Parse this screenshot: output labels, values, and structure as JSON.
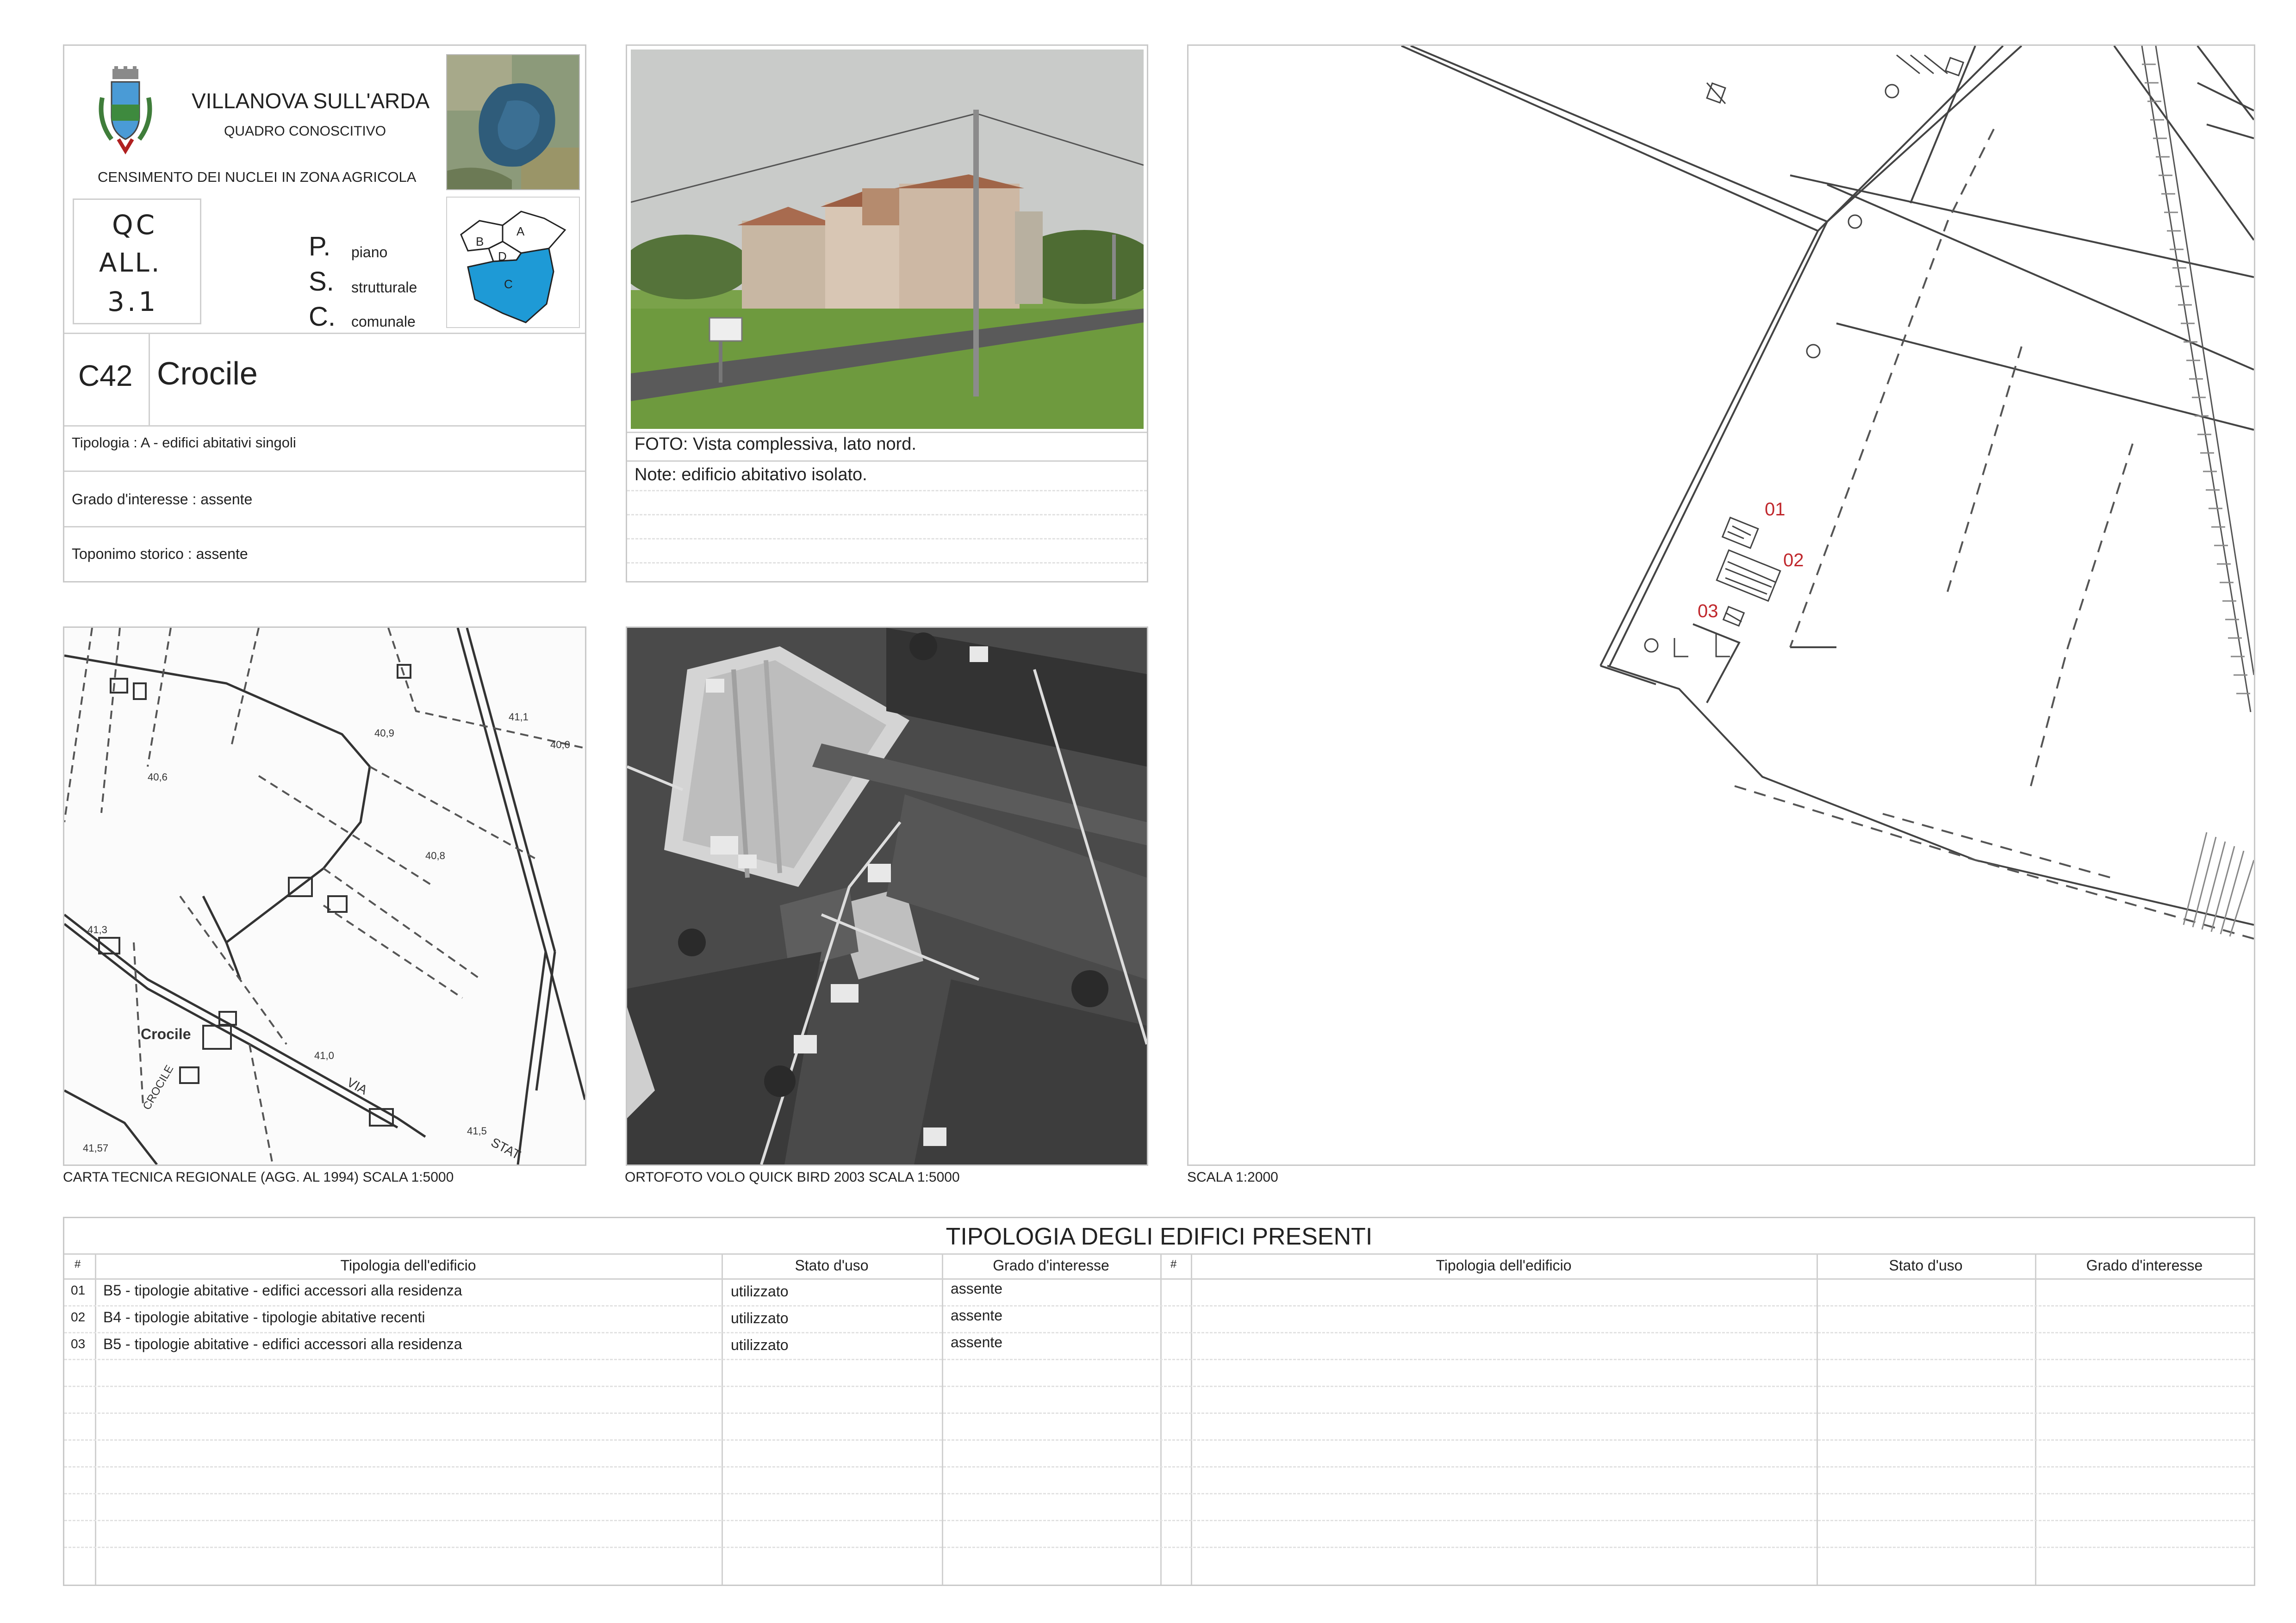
{
  "header": {
    "municipality": "VILLANOVA SULL'ARDA",
    "subtitle": "QUADRO CONOSCITIVO",
    "census": "CENSIMENTO DEI NUCLEI IN ZONA AGRICOLA",
    "qc_lines": [
      "QC",
      "ALL.",
      "3.1"
    ],
    "psc_letters": [
      "P.",
      "S.",
      "C."
    ],
    "psc_words": [
      "piano",
      "strutturale",
      "comunale"
    ],
    "zone_labels": [
      "A",
      "B",
      "C",
      "D"
    ],
    "colors": {
      "zone_c": "#1e9ad6",
      "tag_red": "#c0282d",
      "border": "#c9c9c9"
    }
  },
  "nucleus": {
    "code": "C42",
    "name": "Crocile",
    "tipologia": "Tipologia : A  - edifici abitativi singoli",
    "grado": "Grado d'interesse : assente",
    "toponimo": "Toponimo storico : assente"
  },
  "photo": {
    "caption": "FOTO: Vista complessiva, lato nord.",
    "note": "Note: edificio abitativo isolato."
  },
  "maps": {
    "ctr_caption": "CARTA TECNICA REGIONALE (AGG. AL 1994) SCALA 1:5000",
    "ortho_caption": "ORTOFOTO VOLO QUICK BIRD 2003 SCALA 1:5000",
    "plan_caption": "SCALA 1:2000",
    "ctr_labels": [
      "Crocile",
      "CROCILE",
      "VIA",
      "STAT",
      "40,9",
      "40,8",
      "40,6",
      "41,1",
      "41,3",
      "41,0",
      "41,5",
      "41,57",
      "40,0"
    ],
    "plan_tags": [
      "01",
      "02",
      "03"
    ]
  },
  "table": {
    "title": "TIPOLOGIA DEGLI EDIFICI PRESENTI",
    "headers": {
      "num": "#",
      "tipologia": "Tipologia dell'edificio",
      "stato": "Stato d'uso",
      "grado": "Grado d'interesse"
    },
    "rows": [
      {
        "num": "01",
        "tipologia": "B5 - tipologie abitative - edifici accessori alla residenza",
        "stato": "utilizzato",
        "grado": "assente"
      },
      {
        "num": "02",
        "tipologia": "B4 - tipologie abitative - tipologie abitative recenti",
        "stato": "utilizzato",
        "grado": "assente"
      },
      {
        "num": "03",
        "tipologia": "B5 - tipologie abitative - edifici accessori alla residenza",
        "stato": "utilizzato",
        "grado": "assente"
      }
    ]
  }
}
